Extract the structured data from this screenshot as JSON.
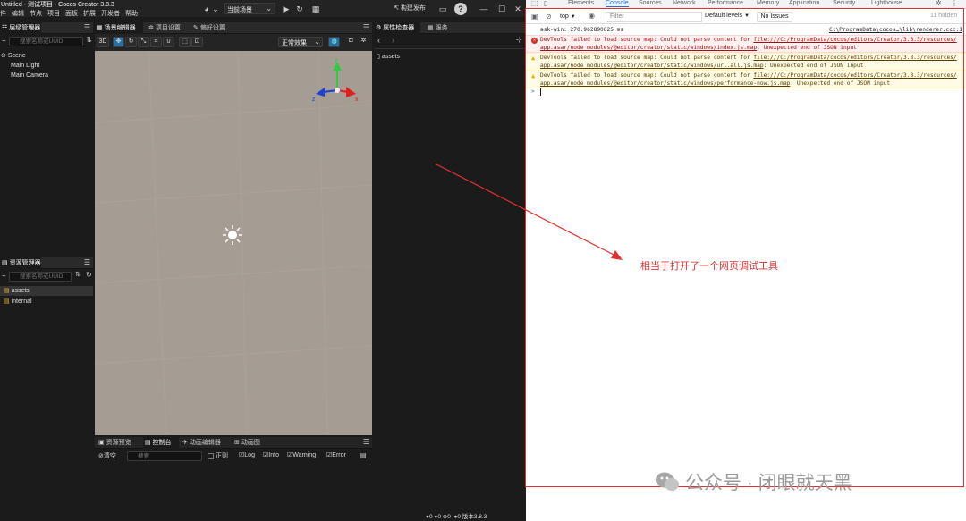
{
  "app": {
    "title": "Untitled - 测试项目 - Cocos Creator 3.8.3",
    "menu": [
      "件",
      "编辑",
      "节点",
      "项目",
      "面板",
      "扩展",
      "开发者",
      "帮助"
    ],
    "scene_select": "当前场景",
    "build_publish": "构建发布"
  },
  "hierarchy": {
    "tab": "层级管理器",
    "search_placeholder": "搜索名称或UUID",
    "items": [
      "Scene",
      "Main Light",
      "Main Camera"
    ]
  },
  "scene_editor": {
    "tabs": [
      "场景编辑器",
      "项目设置",
      "偏好设置"
    ],
    "buttons": [
      "3D"
    ],
    "mode_select": "正常效果"
  },
  "inspector": {
    "tabs": [
      "属性检查器",
      "服务"
    ],
    "item": "assets"
  },
  "assets": {
    "tab": "资源管理器",
    "search_placeholder": "搜索名称或UUID",
    "items": [
      "assets",
      "internal"
    ]
  },
  "console_panel": {
    "tabs": [
      "资源预览",
      "控制台",
      "动画编辑器",
      "动画图"
    ],
    "clear": "清空",
    "search_placeholder": "搜索",
    "regex": "正则",
    "filters": [
      "Log",
      "Info",
      "Warning",
      "Error"
    ]
  },
  "statusbar": {
    "counts": [
      "0",
      "0",
      "0"
    ],
    "extra": "0",
    "version": "版本3.8.3"
  },
  "devtools": {
    "tabs": [
      "Elements",
      "Console",
      "Sources",
      "Network",
      "Performance",
      "Memory",
      "Application",
      "Security",
      "Lighthouse"
    ],
    "active_tab": "Console",
    "context": "top",
    "filter_placeholder": "Filter",
    "levels": "Default levels",
    "no_issues": "No Issues",
    "hidden": "11 hidden",
    "messages": [
      {
        "type": "log",
        "text": "ask-win: 270.962890625 ms",
        "source": "C:\\ProgramData\\cocos…\\lib\\renderer.ccc:1"
      },
      {
        "type": "error",
        "line1": "DevTools failed to load source map: Could not parse content for ",
        "link1": "file:///C:/ProgramData/cocos/editors/Creator/3.8.3/resources/",
        "link2": "app.asar/node_modules/@editor/creator/static/windows/index.js.map",
        "tail": ": Unexpected end of JSON input"
      },
      {
        "type": "warning",
        "line1": "DevTools failed to load source map: Could not parse content for ",
        "link1": "file:///C:/ProgramData/cocos/editors/Creator/3.8.3/resources/",
        "link2": "app.asar/node_modules/@editor/creator/static/windows/url.all.js.map",
        "tail": ": Unexpected end of JSON input"
      },
      {
        "type": "warning",
        "line1": "DevTools failed to load source map: Could not parse content for ",
        "link1": "file:///C:/ProgramData/cocos/editors/Creator/3.8.3/resources/",
        "link2": "app.asar/node_modules/@editor/creator/static/windows/performance-now.js.map",
        "tail": ": Unexpected end of JSON input"
      }
    ],
    "prompt": ">"
  },
  "annotation": {
    "text": "相当于打开了一个网页调试工具",
    "color": "#e03030"
  },
  "watermark": {
    "text": "公众号 · 闭眼就天黑"
  },
  "colors": {
    "accent": "#1a73e8",
    "highlight_box": "#e03030",
    "scene_bg": "#a59c94"
  }
}
